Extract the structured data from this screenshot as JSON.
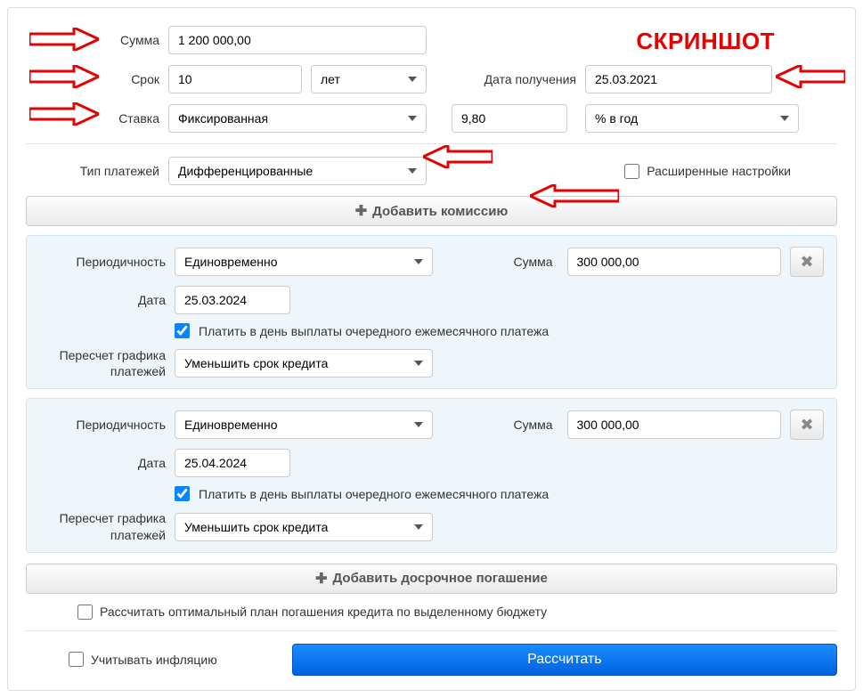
{
  "badge": "СКРИНШОТ",
  "labels": {
    "amount": "Сумма",
    "term": "Срок",
    "rate": "Ставка",
    "receive_date": "Дата получения",
    "payment_type": "Тип платежей",
    "advanced": "Расширенные настройки",
    "add_commission": "Добавить комиссию",
    "periodicity": "Периодичность",
    "sum": "Сумма",
    "date": "Дата",
    "pay_on_schedule": "Платить в день выплаты очередного ежемесячного платежа",
    "recalc": "Пересчет графика платежей",
    "add_prepay": "Добавить досрочное погашение",
    "optimal_plan": "Рассчитать оптимальный план погашения кредита по выделенному бюджету",
    "inflation": "Учитывать инфляцию",
    "calculate": "Рассчитать"
  },
  "values": {
    "amount": "1 200 000,00",
    "term": "10",
    "term_unit": "лет",
    "rate_type": "Фиксированная",
    "rate_value": "9,80",
    "rate_unit": "% в год",
    "receive_date": "25.03.2021",
    "payment_type": "Дифференцированные",
    "advanced_checked": false
  },
  "prepayments": [
    {
      "periodicity": "Единовременно",
      "sum": "300 000,00",
      "date": "25.03.2024",
      "pay_on_schedule": true,
      "recalc": "Уменьшить срок кредита"
    },
    {
      "periodicity": "Единовременно",
      "sum": "300 000,00",
      "date": "25.04.2024",
      "pay_on_schedule": true,
      "recalc": "Уменьшить срок кредита"
    }
  ],
  "bottom": {
    "optimal_checked": false,
    "inflation_checked": false
  }
}
